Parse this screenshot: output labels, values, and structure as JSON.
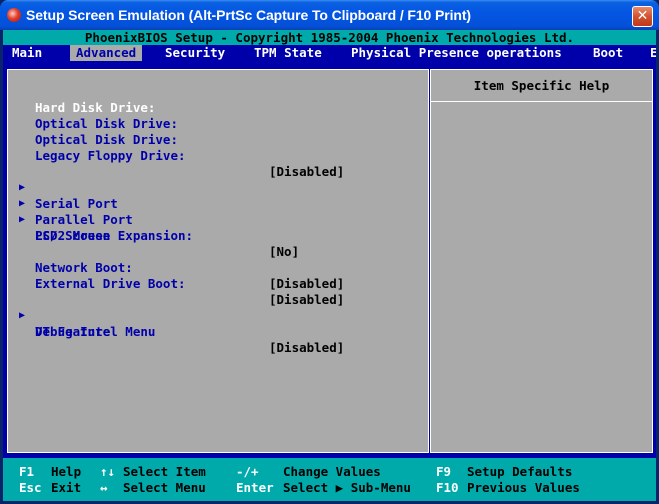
{
  "window": {
    "title": "Setup Screen Emulation (Alt-PrtSc Capture To Clipboard / F10 Print)",
    "close_glyph": "✕"
  },
  "bios": {
    "header": "PhoenixBIOS Setup - Copyright 1985-2004 Phoenix Technologies Ltd."
  },
  "menu": {
    "items": [
      "Main",
      "Advanced",
      "Security",
      "TPM State",
      "Physical Presence operations",
      "Boot",
      "E"
    ],
    "active": "Advanced"
  },
  "settings": {
    "hard_disk_drive": {
      "label": "Hard Disk Drive:"
    },
    "optical_disk_drive_1": {
      "label": "Optical Disk Drive:"
    },
    "optical_disk_drive_2": {
      "label": "Optical Disk Drive:"
    },
    "legacy_floppy_drive": {
      "label": "Legacy Floppy Drive:",
      "value": "[Disabled]"
    },
    "serial_port": {
      "label": "Serial Port",
      "arrow": "▶"
    },
    "parallel_port": {
      "label": "Parallel Port",
      "arrow": "▶"
    },
    "ps2_mouse": {
      "label": "PS/2 Mouse",
      "arrow": "▶"
    },
    "lcd_screen_expansion": {
      "label": "LCD Screen Expansion:",
      "value": "[No]"
    },
    "network_boot": {
      "label": "Network Boot:",
      "value": "[Disabled]"
    },
    "external_drive_boot": {
      "label": "External Drive Boot:",
      "value": "[Disabled]"
    },
    "debug_intel_menu": {
      "label": "Debug Intel Menu",
      "arrow": "▶"
    },
    "vt_feature": {
      "label": "VT Feature",
      "value": "[Disabled]"
    }
  },
  "help": {
    "title": "Item Specific Help"
  },
  "footer": {
    "row1": [
      {
        "key": "F1",
        "desc": "Help"
      },
      {
        "key": "↑↓",
        "desc": "Select Item"
      },
      {
        "key": "-/+",
        "desc": "Change Values"
      },
      {
        "key": "F9",
        "desc": "Setup Defaults"
      }
    ],
    "row2": [
      {
        "key": "Esc",
        "desc": "Exit"
      },
      {
        "key": "↔",
        "desc": "Select Menu"
      },
      {
        "key": "Enter",
        "desc": "Select ▶ Sub-Menu"
      },
      {
        "key": "F10",
        "desc": "Previous Values"
      }
    ]
  },
  "colors": {
    "bios_blue": "#0000aa",
    "bios_gray": "#aaaaaa",
    "bios_cyan": "#00aaaa",
    "xp_title_blue": "#0451d8"
  }
}
